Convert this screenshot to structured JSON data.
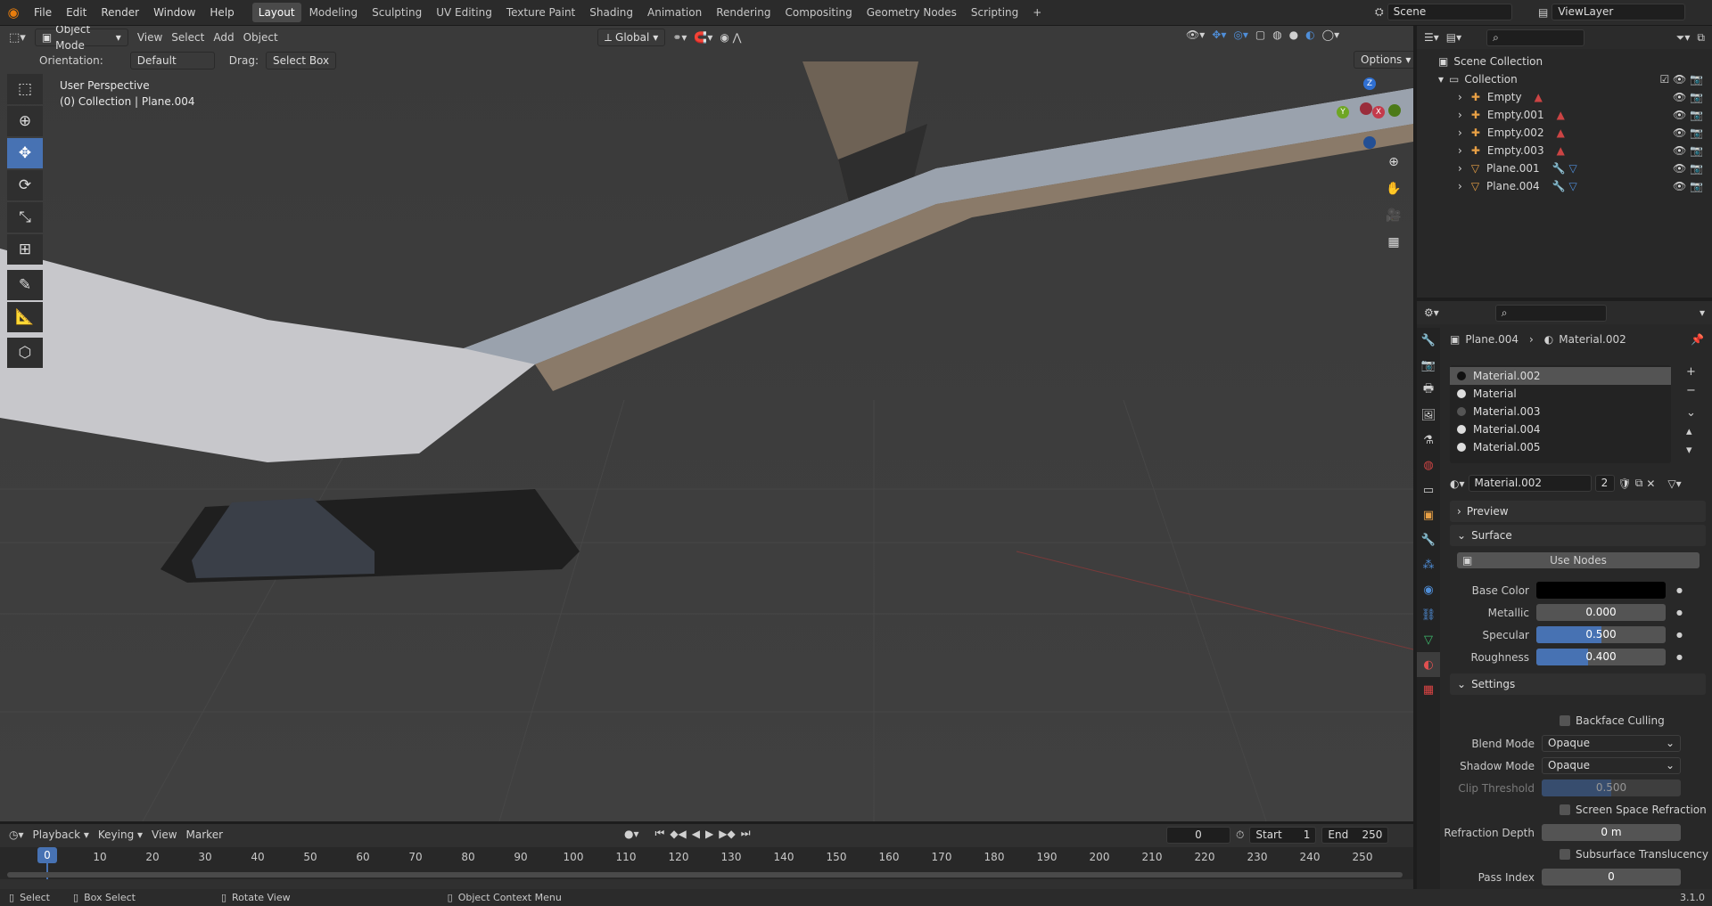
{
  "topbar": {
    "menus": [
      "File",
      "Edit",
      "Render",
      "Window",
      "Help"
    ],
    "workspaces": [
      "Layout",
      "Modeling",
      "Sculpting",
      "UV Editing",
      "Texture Paint",
      "Shading",
      "Animation",
      "Rendering",
      "Compositing",
      "Geometry Nodes",
      "Scripting"
    ],
    "active_workspace": "Layout",
    "add_tab": "+",
    "scene": "Scene",
    "view_layer": "ViewLayer"
  },
  "viewport": {
    "mode": "Object Mode",
    "menus": [
      "View",
      "Select",
      "Add",
      "Object"
    ],
    "transform": "Global",
    "orientation_label": "Orientation:",
    "orientation_value": "Default",
    "drag_label": "Drag:",
    "drag_value": "Select Box",
    "options": "Options",
    "info_line1": "User Perspective",
    "info_line2": "(0) Collection | Plane.004",
    "gizmo": {
      "z": "Z",
      "y": "Y",
      "x": "X"
    }
  },
  "outliner": {
    "root": "Scene Collection",
    "collection": "Collection",
    "items": [
      {
        "name": "Empty",
        "type": "empty"
      },
      {
        "name": "Empty.001",
        "type": "empty"
      },
      {
        "name": "Empty.002",
        "type": "empty"
      },
      {
        "name": "Empty.003",
        "type": "empty"
      },
      {
        "name": "Plane.001",
        "type": "mesh"
      },
      {
        "name": "Plane.004",
        "type": "mesh"
      }
    ]
  },
  "properties": {
    "breadcrumb_object": "Plane.004",
    "breadcrumb_material": "Material.002",
    "slots": [
      "Material.002",
      "Material",
      "Material.003",
      "Material.004",
      "Material.005"
    ],
    "selected_slot": "Material.002",
    "material_name": "Material.002",
    "users": "2",
    "preview": "Preview",
    "surface": "Surface",
    "use_nodes": "Use Nodes",
    "base_color_label": "Base Color",
    "base_color": "#000000",
    "metallic_label": "Metallic",
    "metallic": "0.000",
    "metallic_fraction": 0,
    "specular_label": "Specular",
    "specular": "0.500",
    "specular_fraction": 0.5,
    "roughness_label": "Roughness",
    "roughness": "0.400",
    "roughness_fraction": 0.4,
    "settings": "Settings",
    "backface_culling": "Backface Culling",
    "blend_mode_label": "Blend Mode",
    "blend_mode": "Opaque",
    "shadow_mode_label": "Shadow Mode",
    "shadow_mode": "Opaque",
    "clip_threshold_label": "Clip Threshold",
    "clip_threshold": "0.500",
    "clip_threshold_fraction": 0.5,
    "ssr": "Screen Space Refraction",
    "refraction_depth_label": "Refraction Depth",
    "refraction_depth": "0 m",
    "subsurface_translucency": "Subsurface Translucency",
    "pass_index_label": "Pass Index",
    "pass_index": "0"
  },
  "timeline": {
    "menus": [
      "Playback",
      "Keying",
      "View",
      "Marker"
    ],
    "current_frame": "0",
    "start_label": "Start",
    "start": "1",
    "end_label": "End",
    "end": "250",
    "ticks": [
      "0",
      "10",
      "20",
      "30",
      "40",
      "50",
      "60",
      "70",
      "80",
      "90",
      "100",
      "110",
      "120",
      "130",
      "140",
      "150",
      "160",
      "170",
      "180",
      "190",
      "200",
      "210",
      "220",
      "230",
      "240",
      "250"
    ]
  },
  "statusbar": {
    "select": "Select",
    "box_select": "Box Select",
    "rotate_view": "Rotate View",
    "context_menu": "Object Context Menu",
    "version": "3.1.0"
  },
  "colors": {
    "accent": "#4772b3",
    "header": "#2b2b2b",
    "viewport": "#3c3c3c"
  }
}
